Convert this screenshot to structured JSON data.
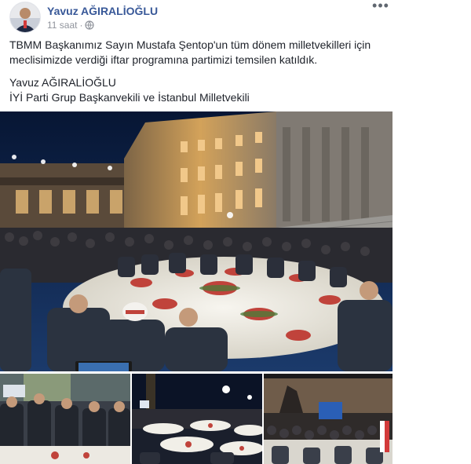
{
  "post": {
    "author": "Yavuz AĞIRALİOĞLU",
    "timestamp": "11 saat",
    "separator": "·",
    "privacy_icon": "globe-icon",
    "more_icon": "more-options-icon",
    "more_label": "•••",
    "body": {
      "line1": "TBMM Başkanımız Sayın Mustafa Şentop'un tüm dönem milletvekilleri için meclisimizde verdiği iftar programına partimizi temsilen katıldık.",
      "signature_name": "Yavuz AĞIRALİOĞLU",
      "signature_title": "İYİ Parti Grup Başkanvekili ve İstanbul Milletvekili"
    }
  },
  "colors": {
    "author_link": "#385898",
    "meta_text": "#90949c",
    "body_text": "#1d2129",
    "night_sky": "#0a1a3a",
    "building_lit": "#c99a4e",
    "tablecloth": "#f2f0ea"
  },
  "gallery": {
    "photos": [
      {
        "name": "main-photo",
        "desc_icon": "iftar-dinner-photo"
      },
      {
        "name": "thumb-photo-1",
        "desc_icon": "guests-at-tables-photo"
      },
      {
        "name": "thumb-photo-2",
        "desc_icon": "courtyard-tables-photo"
      },
      {
        "name": "thumb-photo-3",
        "desc_icon": "crowd-with-screen-photo"
      }
    ]
  }
}
